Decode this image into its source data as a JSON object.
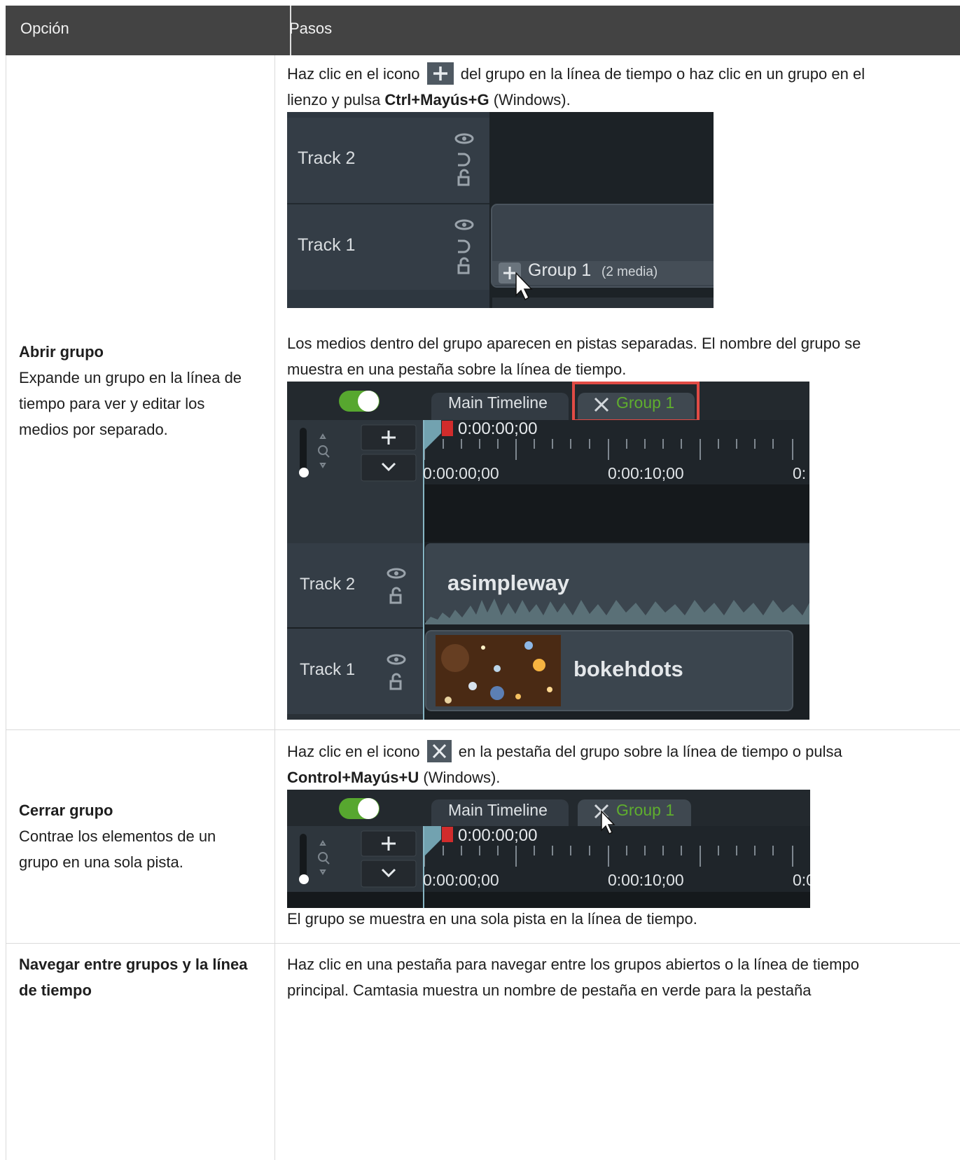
{
  "table": {
    "headers": {
      "option": "Opción",
      "steps": "Pasos"
    },
    "rows": [
      {
        "title": "Abrir grupo",
        "desc_l1": "Expande un grupo en la línea de",
        "desc_l2": "tiempo para ver y editar los",
        "desc_l3": "medios por separado.",
        "step1_pre": "Haz clic en el icono",
        "step1_post": "del grupo en la línea de tiempo o haz clic en un grupo en el",
        "step1_l2_pre": "lienzo y pulsa ",
        "step1_l2_bold": "Ctrl+Mayús+G",
        "step1_l2_post": " (Windows).",
        "step2_l1": "Los medios dentro del grupo aparecen en pistas separadas. El nombre del grupo se",
        "step2_l2": "muestra en una pestaña sobre la línea de tiempo."
      },
      {
        "title": "Cerrar grupo",
        "desc_l1": "Contrae los elementos de un",
        "desc_l2": "grupo en una sola pista.",
        "step1_pre": "Haz clic en el icono",
        "step1_post": "en la pestaña del grupo sobre la línea de tiempo o pulsa",
        "step1_l2_bold": "Control+Mayús+U",
        "step1_l2_post": " (Windows).",
        "step2": "El grupo se muestra en una sola pista en la línea de tiempo."
      },
      {
        "title_l1": "Navegar entre grupos y la línea",
        "title_l2": "de tiempo",
        "step_l1": "Haz clic en una pestaña para navegar entre los grupos abiertos o la línea de tiempo",
        "step_l2": "principal. Camtasia muestra un nombre de pestaña en verde para la pestaña"
      }
    ]
  },
  "shot1": {
    "track2": "Track 2",
    "track1": "Track 1",
    "group_label": "Group 1",
    "group_count": "(2 media)"
  },
  "shot2": {
    "tab_main": "Main Timeline",
    "tab_group": "Group 1",
    "playhead_time": "0:00:00;00",
    "ruler_t0": "0:00:00;00",
    "ruler_t1": "0:00:10;00",
    "ruler_t2": "0:",
    "track2": "Track 2",
    "track1": "Track 1",
    "clip_audio": "asimpleway",
    "clip_video": "bokehdots"
  },
  "shot3": {
    "tab_main": "Main Timeline",
    "tab_group": "Group 1",
    "playhead_time": "0:00:00;00",
    "ruler_t0": "0:00:00;00",
    "ruler_t1": "0:00:10;00",
    "ruler_t2": "0:0"
  },
  "colors": {
    "header_bg": "#434343",
    "group_tab_green": "#5fae2e",
    "highlight_red": "#e14b45",
    "toggle_green": "#57a72f"
  }
}
